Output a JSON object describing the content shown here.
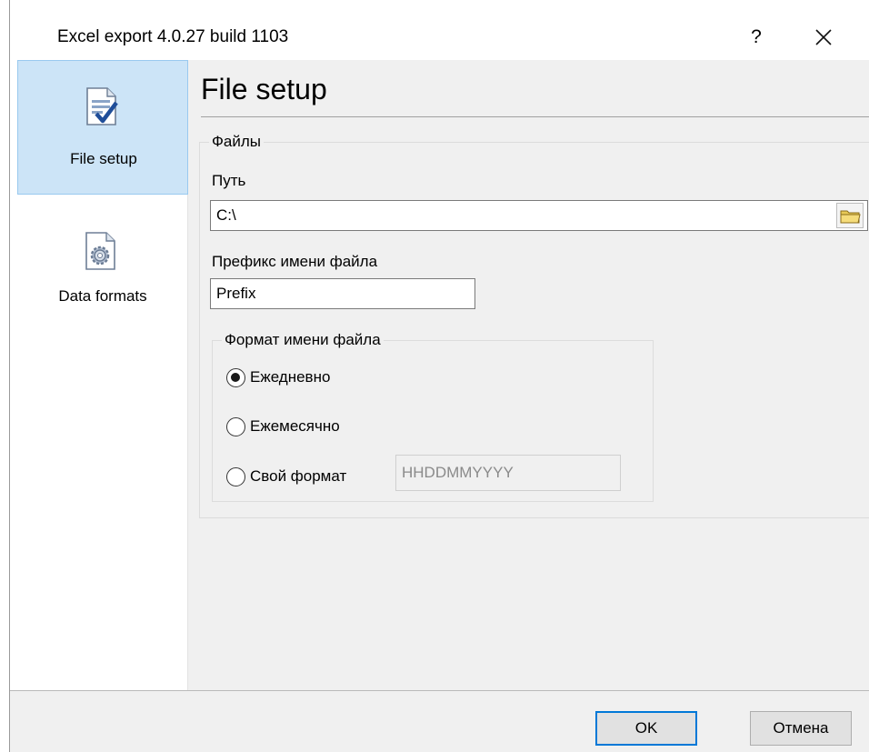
{
  "window": {
    "title": "Excel export 4.0.27 build 1103",
    "help_label": "?"
  },
  "sidebar": {
    "items": [
      {
        "label": "File setup",
        "icon": "document-check-icon",
        "selected": true
      },
      {
        "label": "Data formats",
        "icon": "gear-document-icon",
        "selected": false
      }
    ]
  },
  "page": {
    "title": "File setup"
  },
  "files_group": {
    "legend": "Файлы",
    "path_label": "Путь",
    "path_value": "C:\\",
    "prefix_label": "Префикс имени файла",
    "prefix_value": "Prefix"
  },
  "format_group": {
    "legend": "Формат имени файла",
    "options": [
      {
        "label": "Ежедневно",
        "checked": true
      },
      {
        "label": "Ежемесячно",
        "checked": false
      },
      {
        "label": "Свой формат",
        "checked": false
      }
    ],
    "custom_format_value": "HHDDMMYYYY"
  },
  "footer": {
    "ok_label": "OK",
    "cancel_label": "Отмена"
  },
  "colors": {
    "selection_bg": "#cce4f7",
    "selection_border": "#99c9ef",
    "default_button_border": "#0078d7",
    "folder_icon": "#e8c957"
  }
}
